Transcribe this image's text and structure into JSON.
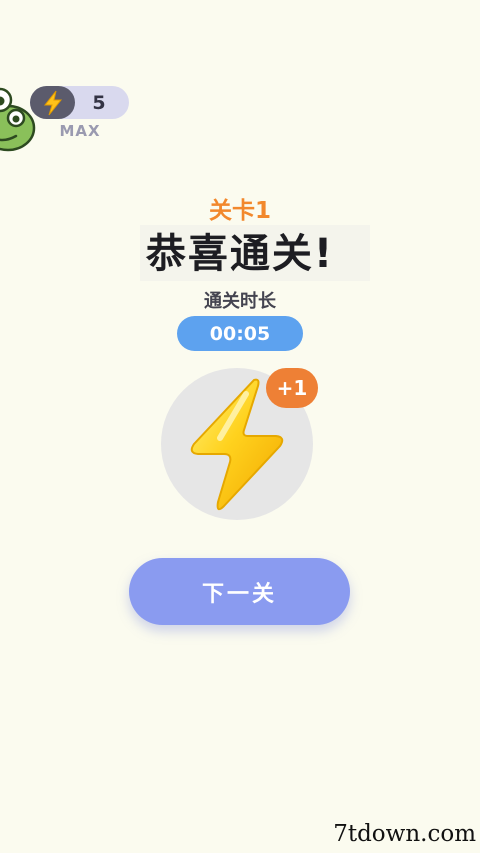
{
  "status_bar": {
    "energy_count": "5",
    "max_label": "MAX"
  },
  "result": {
    "level_label": "关卡1",
    "title": "恭喜通关!",
    "time_label": "通关时长",
    "time_value": "00:05"
  },
  "reward": {
    "icon": "lightning-bolt-icon",
    "bonus_label": "+1"
  },
  "actions": {
    "next_label": "下一关"
  },
  "watermark": {
    "text": "7tdown.com"
  },
  "colors": {
    "background": "#fbfbef",
    "accent_orange": "#f2882c",
    "time_pill": "#5da2ef",
    "button": "#8a9bf0",
    "bolt_yellow": "#ffd21e"
  }
}
